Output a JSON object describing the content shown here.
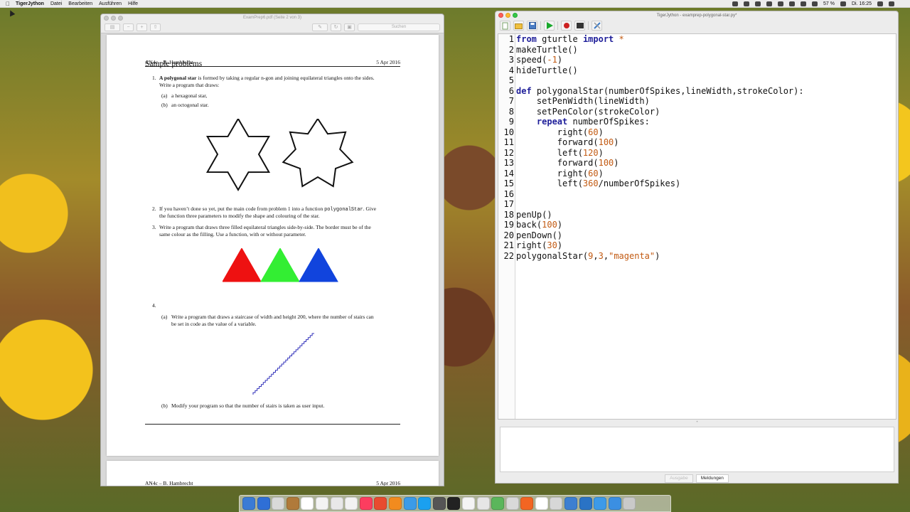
{
  "menubar": {
    "app_name": "TigerJython",
    "menus": [
      "Datei",
      "Bearbeiten",
      "Ausführen",
      "Hilfe"
    ],
    "battery": "57 %",
    "clock": "Di. 16:25"
  },
  "preview": {
    "title": "ExamPrep6.pdf (Seite 2 von 3)",
    "search_placeholder": "Suchen",
    "page": {
      "header_left": "AN4c – B. Hambrecht",
      "header_right": "5 Apr 2016",
      "section_title": "Sample problems",
      "p1_num": "1.",
      "p1_bold": "A polygonal star",
      "p1_rest": " is formed by taking a regular n-gon and joining equilateral triangles onto the sides.",
      "p1_line2": "Write a program that draws:",
      "p1a_label": "(a)",
      "p1a_text": "a hexagonal star,",
      "p1b_label": "(b)",
      "p1b_text": "an octogonal star.",
      "p2_num": "2.",
      "p2_line1_a": "If you haven’t done so yet, put the main code from problem 1 into a function ",
      "p2_line1_code": "polygonalStar",
      "p2_line1_b": ". Give",
      "p2_line2": "the function three parameters to modify the shape and colouring of the star.",
      "p3_num": "3.",
      "p3_line1": "Write a program that draws three filled equilateral triangles side-by-side. The border must be of the",
      "p3_line2": "same colour as the filling. Use a function, with or without parameter.",
      "p4_num": "4.",
      "p4a_label": "(a)",
      "p4a_line1": "Write a program that draws a staircase of width and height 200, where the number of stairs can",
      "p4a_line2": "be set in code as the value of a variable.",
      "p4b_label": "(b)",
      "p4b_text": "Modify your program so that the number of stairs is taken as user input."
    },
    "page2": {
      "header_left": "AN4c – B. Hambrecht",
      "header_right": "5 Apr 2016"
    },
    "triangle_colors": [
      "#ee1111",
      "#33ee33",
      "#1144dd"
    ],
    "stair_color": "#3333bb"
  },
  "editor": {
    "title": "TigerJython - examprep-polygonal-star.py*",
    "line_numbers": [
      "1",
      "2",
      "3",
      "4",
      "5",
      "6",
      "7",
      "8",
      "9",
      "10",
      "11",
      "12",
      "13",
      "14",
      "15",
      "16",
      "17",
      "18",
      "19",
      "20",
      "21",
      "22"
    ],
    "tokens": {
      "l1_kw1": "from",
      "l1_mod": " gturtle ",
      "l1_kw2": "import",
      "l1_star": " *",
      "l2": "makeTurtle()",
      "l3_a": "speed(",
      "l3_num": "-1",
      "l3_b": ")",
      "l4": "hideTurtle()",
      "l6_kw": "def",
      "l6_rest": " polygonalStar(numberOfSpikes,lineWidth,strokeColor):",
      "l7": "    setPenWidth(lineWidth)",
      "l8": "    setPenColor(strokeColor)",
      "l9_indent": "    ",
      "l9_kw": "repeat",
      "l9_rest": " numberOfSpikes:",
      "l10_a": "        right(",
      "l10_num": "60",
      "l10_b": ")",
      "l11_a": "        forward(",
      "l11_num": "100",
      "l11_b": ")",
      "l12_a": "        left(",
      "l12_num": "120",
      "l12_b": ")",
      "l13_a": "        forward(",
      "l13_num": "100",
      "l13_b": ")",
      "l14_a": "        right(",
      "l14_num": "60",
      "l14_b": ")",
      "l15_a": "        left(",
      "l15_num": "360",
      "l15_b": "/numberOfSpikes)",
      "l18": "penUp()",
      "l19_a": "back(",
      "l19_num": "100",
      "l19_b": ")",
      "l20": "penDown()",
      "l21_a": "right(",
      "l21_num": "30",
      "l21_b": ")",
      "l22_a": "polygonalStar(",
      "l22_n1": "9",
      "l22_c1": ",",
      "l22_n2": "3",
      "l22_c2": ",",
      "l22_str": "\"magenta\"",
      "l22_b": ")"
    },
    "tabs": [
      "Meldungen"
    ],
    "inactive_tab": "Ausgabe"
  },
  "dock": {
    "icon_colors": [
      "#3a7bd5",
      "#2f6fd6",
      "#d9d9d9",
      "#b07a3a",
      "#ffffff",
      "#f3f3f3",
      "#e8e8e8",
      "#f2f2f2",
      "#fc3d5f",
      "#e84b2f",
      "#f28b1e",
      "#3b9be8",
      "#1aa0f0",
      "#555555",
      "#222222",
      "#f4f4f4",
      "#e6e6e6",
      "#5bb65b",
      "#d9d9d9",
      "#f26522",
      "#ffffff",
      "#d7d7d7",
      "#3d7fd1",
      "#2a73c5",
      "#3d9ae8",
      "#3b8fe2",
      "#c9c9c9"
    ]
  }
}
